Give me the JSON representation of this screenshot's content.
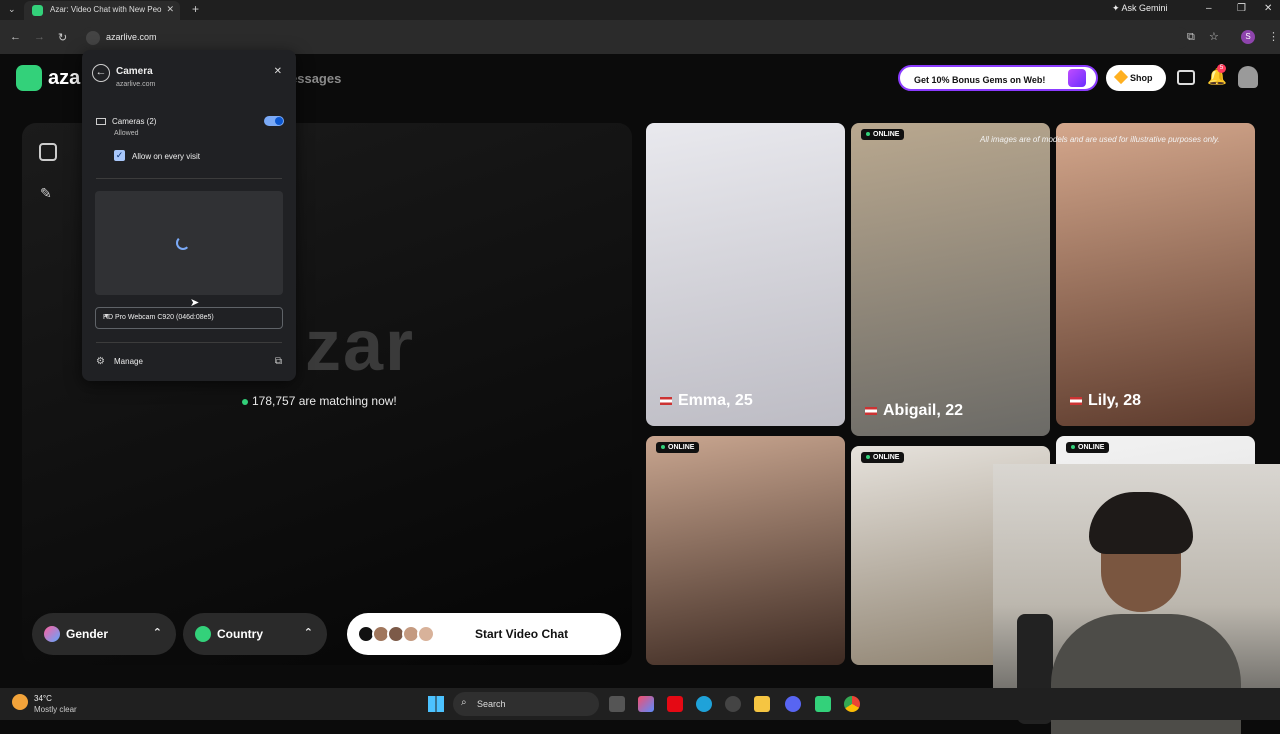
{
  "browser": {
    "tab_title": "Azar: Video Chat with New People",
    "tab_close": "✕",
    "new_tab": "+",
    "ask_gemini": "Ask Gemini",
    "url": "azarlive.com",
    "profile_initial": "S"
  },
  "site": {
    "logo_text": "aza",
    "nav_messages": "essages",
    "bonus_label": "Get 10% Bonus Gems on Web!",
    "shop_label": "Shop",
    "notification_count": "5",
    "brand_big": "zar",
    "matching_text": "178,757 are matching now!",
    "gender_label": "Gender",
    "country_label": "Country",
    "start_label": "Start Video Chat",
    "notice": "All images are of models and are used for illustrative purposes only.",
    "cards": [
      {
        "name": "Emma, 25",
        "online": "",
        "color1": "#e9e9ee",
        "color2": "#bdbcc4"
      },
      {
        "name": "Abigail, 22",
        "online": "ONLINE",
        "color1": "#b9a88f",
        "color2": "#6b6a66"
      },
      {
        "name": "Lily, 28",
        "online": "",
        "color1": "#d4a78c",
        "color2": "#5d3b2d"
      },
      {
        "name": "",
        "online": "ONLINE",
        "color1": "#c9a690",
        "color2": "#3d2a22"
      },
      {
        "name": "",
        "online": "ONLINE",
        "color1": "#e6e2dc",
        "color2": "#8e8270"
      },
      {
        "name": "",
        "online": "ONLINE",
        "color1": "#f2f2f2",
        "color2": "#d8d8d8"
      }
    ]
  },
  "popup": {
    "title": "Camera",
    "site": "azarlive.com",
    "permission_label": "Cameras (2)",
    "permission_status": "Allowed",
    "allow_every_visit": "Allow on every visit",
    "device": "HD Pro Webcam C920 (046d:08e5)",
    "manage": "Manage"
  },
  "taskbar": {
    "temp": "34°C",
    "condition": "Mostly clear",
    "search_label": "Search"
  },
  "colors": {
    "accent": "#33d17a",
    "bonus_border": "#8b3bff"
  }
}
